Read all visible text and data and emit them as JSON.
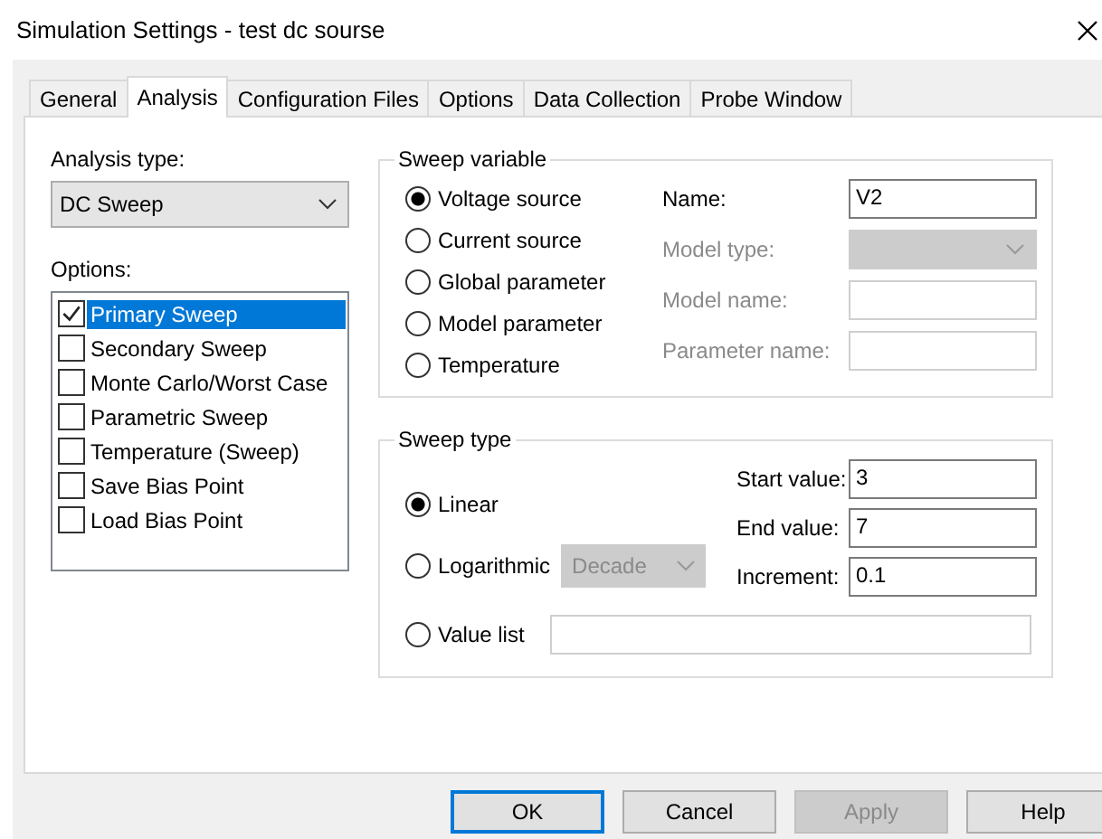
{
  "window": {
    "title": "Simulation Settings - test dc sourse"
  },
  "tabs": [
    {
      "label": "General",
      "selected": false
    },
    {
      "label": "Analysis",
      "selected": true
    },
    {
      "label": "Configuration Files",
      "selected": false
    },
    {
      "label": "Options",
      "selected": false
    },
    {
      "label": "Data Collection",
      "selected": false
    },
    {
      "label": "Probe Window",
      "selected": false
    }
  ],
  "analysis_type": {
    "label": "Analysis type:",
    "value": "DC Sweep"
  },
  "options": {
    "label": "Options:",
    "items": [
      {
        "label": "Primary Sweep",
        "checked": true,
        "selected": true
      },
      {
        "label": "Secondary Sweep",
        "checked": false,
        "selected": false
      },
      {
        "label": "Monte Carlo/Worst Case",
        "checked": false,
        "selected": false
      },
      {
        "label": "Parametric Sweep",
        "checked": false,
        "selected": false
      },
      {
        "label": "Temperature (Sweep)",
        "checked": false,
        "selected": false
      },
      {
        "label": "Save Bias Point",
        "checked": false,
        "selected": false
      },
      {
        "label": "Load Bias Point",
        "checked": false,
        "selected": false
      }
    ]
  },
  "sweep_variable": {
    "title": "Sweep variable",
    "sources": [
      {
        "label": "Voltage source",
        "selected": true
      },
      {
        "label": "Current source",
        "selected": false
      },
      {
        "label": "Global parameter",
        "selected": false
      },
      {
        "label": "Model parameter",
        "selected": false
      },
      {
        "label": "Temperature",
        "selected": false
      }
    ],
    "fields": [
      {
        "label": "Name:",
        "value": "V2",
        "disabled": false,
        "kind": "text"
      },
      {
        "label": "Model type:",
        "disabled": true,
        "kind": "dropdown"
      },
      {
        "label": "Model name:",
        "disabled": true,
        "kind": "text"
      },
      {
        "label": "Parameter name:",
        "disabled": true,
        "kind": "text"
      }
    ]
  },
  "sweep_type": {
    "title": "Sweep type",
    "modes": [
      {
        "label": "Linear",
        "selected": true,
        "kind": "plain"
      },
      {
        "label": "Logarithmic",
        "selected": false,
        "kind": "scale",
        "scale": {
          "value": "Decade",
          "disabled": true
        }
      },
      {
        "label": "Value list",
        "selected": false,
        "kind": "list"
      }
    ],
    "fields": [
      {
        "label": "Start value:",
        "value": "3"
      },
      {
        "label": "End value:",
        "value": "7"
      },
      {
        "label": "Increment:",
        "value": "0.1"
      }
    ]
  },
  "buttons": [
    {
      "label": "OK",
      "default": true,
      "disabled": false
    },
    {
      "label": "Cancel",
      "default": false,
      "disabled": false
    },
    {
      "label": "Apply",
      "default": false,
      "disabled": true
    },
    {
      "label": "Help",
      "default": false,
      "disabled": false
    }
  ]
}
